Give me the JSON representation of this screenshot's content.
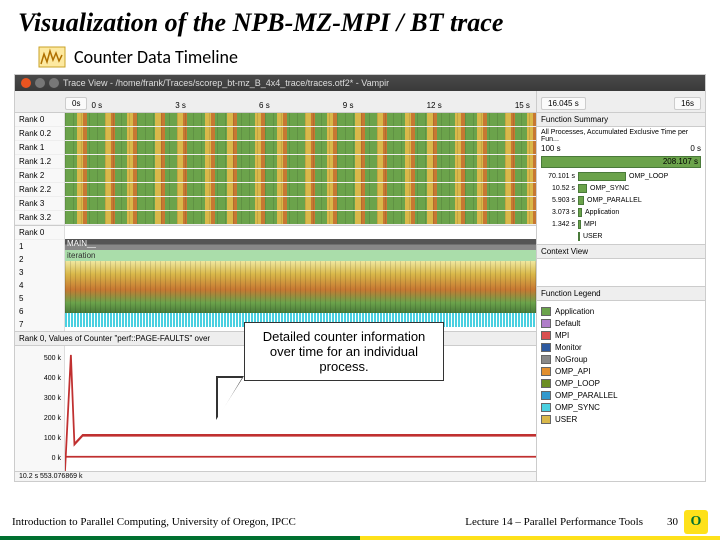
{
  "slide": {
    "title": "Visualization of the NPB-MZ-MPI / BT trace",
    "section": "Counter Data Timeline"
  },
  "window": {
    "title": "Trace View - /home/frank/Traces/scorep_bt-mz_B_4x4_trace/traces.otf2* - Vampir"
  },
  "timeline": {
    "start_box": "0s",
    "end_box": "16s",
    "total_box": "16.045 s",
    "ticks": [
      "0 s",
      "3 s",
      "6 s",
      "9 s",
      "12 s",
      "15 s"
    ],
    "ranks": [
      "Rank 0",
      "Rank 0.2",
      "Rank 1",
      "Rank 1.2",
      "Rank 2",
      "Rank 2.2",
      "Rank 3",
      "Rank 3.2"
    ],
    "detail_rank": "Rank 0",
    "detail_rows": [
      "1",
      "2",
      "3",
      "4",
      "5",
      "6",
      "7"
    ],
    "main_label": "MAIN__",
    "iter_label": "iteration"
  },
  "counter": {
    "title": "Rank 0, Values of Counter \"perf::PAGE-FAULTS\" over",
    "ylabels": [
      "500 k",
      "400 k",
      "300 k",
      "200 k",
      "100 k",
      "0 k"
    ],
    "footer": "10.2 s   553.076869 k"
  },
  "function_summary": {
    "title": "Function Summary",
    "subtitle": "All Processes, Accumulated Exclusive Time per Fun...",
    "axis_left": "100 s",
    "axis_right": "0 s",
    "total": "208.107 s",
    "rows": [
      {
        "val": "70.101 s",
        "name": "OMP_LOOP",
        "w": 48
      },
      {
        "val": "10.52 s",
        "name": "OMP_SYNC",
        "w": 9
      },
      {
        "val": "5.903 s",
        "name": "OMP_PARALLEL",
        "w": 6
      },
      {
        "val": "3.073 s",
        "name": "Application",
        "w": 4
      },
      {
        "val": "1.342 s",
        "name": "MPI",
        "w": 3
      },
      {
        "val": "",
        "name": "USER",
        "w": 1
      }
    ]
  },
  "context_view": {
    "title": "Context View"
  },
  "legend": {
    "title": "Function Legend",
    "items": [
      {
        "name": "Application",
        "color": "#6ba34b"
      },
      {
        "name": "Default",
        "color": "#b07dc9"
      },
      {
        "name": "MPI",
        "color": "#d94f4f"
      },
      {
        "name": "Monitor",
        "color": "#2e5aa0"
      },
      {
        "name": "NoGroup",
        "color": "#888888"
      },
      {
        "name": "OMP_API",
        "color": "#e28f2e"
      },
      {
        "name": "OMP_LOOP",
        "color": "#6b8e23"
      },
      {
        "name": "OMP_PARALLEL",
        "color": "#3399cc"
      },
      {
        "name": "OMP_SYNC",
        "color": "#4ad0e0"
      },
      {
        "name": "USER",
        "color": "#d9b84a"
      }
    ]
  },
  "callout": {
    "text": "Detailed counter information over time for an individual process."
  },
  "footer": {
    "left": "Introduction to Parallel Computing, University of Oregon, IPCC",
    "mid": "Lecture 14 – Parallel Performance Tools",
    "page": "30"
  }
}
